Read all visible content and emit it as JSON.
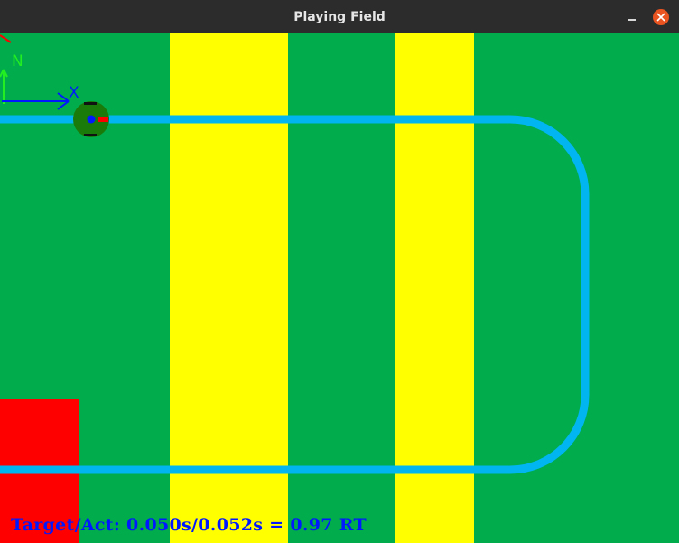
{
  "window": {
    "title": "Playing Field"
  },
  "field": {
    "axes": {
      "north_label": "N",
      "x_label": "X"
    },
    "status_text": "Target/Act: 0.050s/0.052s  =  0.97 RT"
  },
  "colors": {
    "grass": "#00ac4b",
    "lane": "#ffff00",
    "track": "#00b5f0",
    "box": "#ff0000",
    "robot_body": "#1a7a0a",
    "robot_center": "#0018ff",
    "robot_heading": "#ff0000",
    "x_axis": "#0018ff",
    "n_axis": "#22ee22",
    "status_text": "#0018ff"
  },
  "icons": {
    "minimize": "minimize-icon",
    "close": "close-icon"
  }
}
